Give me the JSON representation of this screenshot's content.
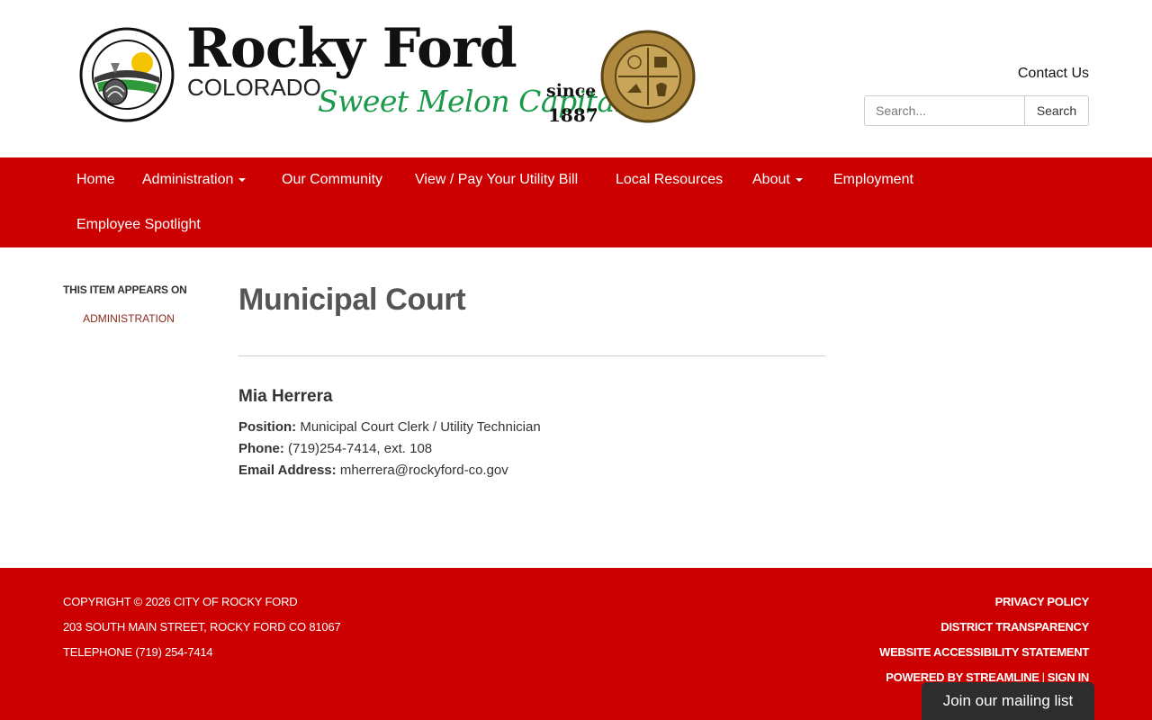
{
  "header": {
    "brand_name": "Rocky Ford",
    "brand_state": "COLORADO",
    "brand_tagline": "Sweet Melon Capital",
    "brand_since": "since",
    "brand_year": "1887",
    "contact_label": "Contact Us",
    "search_placeholder": "Search...",
    "search_button": "Search"
  },
  "nav": {
    "items": [
      {
        "label": "Home"
      },
      {
        "label": "Administration"
      },
      {
        "label": "Our Community"
      },
      {
        "label": "View / Pay Your Utility Bill"
      },
      {
        "label": "Local Resources"
      },
      {
        "label": "About"
      },
      {
        "label": "Employment"
      },
      {
        "label": "Employee Spotlight"
      }
    ]
  },
  "sidebar": {
    "heading": "This item appears on",
    "link": "Administration"
  },
  "main": {
    "title": "Municipal Court",
    "person": {
      "name": "Mia Herrera",
      "position_label": "Position:",
      "position": "Municipal Court Clerk / Utility Technician",
      "phone_label": "Phone:",
      "phone": "(719)254-7414, ext. 108",
      "email_label": "Email Address:",
      "email": "mherrera@rockyford-co.gov"
    }
  },
  "footer": {
    "copyright": "Copyright © 2026 City of Rocky Ford",
    "address": "203 South Main Street, Rocky Ford CO 81067",
    "telephone": "Telephone (719) 254-7414",
    "privacy": "PRIVACY POLICY",
    "transparency": "DISTRICT TRANSPARENCY",
    "accessibility": "WEBSITE ACCESSIBILITY STATEMENT",
    "powered": "POWERED BY STREAMLINE",
    "separator": "|",
    "sign_in": "SIGN IN"
  },
  "mailing": {
    "label": "Join our mailing list"
  },
  "colors": {
    "brand_red": "#cc0000",
    "tagline_green": "#1a9a4a",
    "seal_gold": "#b08a3e"
  }
}
